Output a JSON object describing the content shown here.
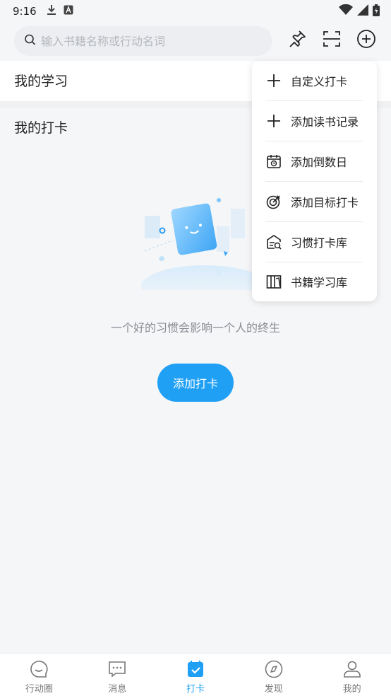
{
  "status": {
    "time": "9:16"
  },
  "search": {
    "placeholder": "输入书籍名称或行动名词",
    "value": ""
  },
  "sections": {
    "study_title": "我的学习",
    "checkin_title": "我的打卡"
  },
  "empty_state": {
    "message": "一个好的习惯会影响一个人的终生",
    "button_label": "添加打卡"
  },
  "menu": {
    "items": [
      {
        "label": "自定义打卡",
        "icon": "plus-icon"
      },
      {
        "label": "添加读书记录",
        "icon": "plus-icon"
      },
      {
        "label": "添加倒数日",
        "icon": "calendar-countdown-icon"
      },
      {
        "label": "添加目标打卡",
        "icon": "target-icon"
      },
      {
        "label": "习惯打卡库",
        "icon": "habit-library-icon"
      },
      {
        "label": "书籍学习库",
        "icon": "book-library-icon"
      }
    ]
  },
  "tabs": [
    {
      "label": "行动圈",
      "icon": "chat-bubble-icon",
      "active": false
    },
    {
      "label": "消息",
      "icon": "message-icon",
      "active": false
    },
    {
      "label": "打卡",
      "icon": "calendar-check-icon",
      "active": true
    },
    {
      "label": "发现",
      "icon": "compass-icon",
      "active": false
    },
    {
      "label": "我的",
      "icon": "person-icon",
      "active": false
    }
  ],
  "colors": {
    "accent": "#1fa0f5",
    "background": "#f5f6f8"
  }
}
